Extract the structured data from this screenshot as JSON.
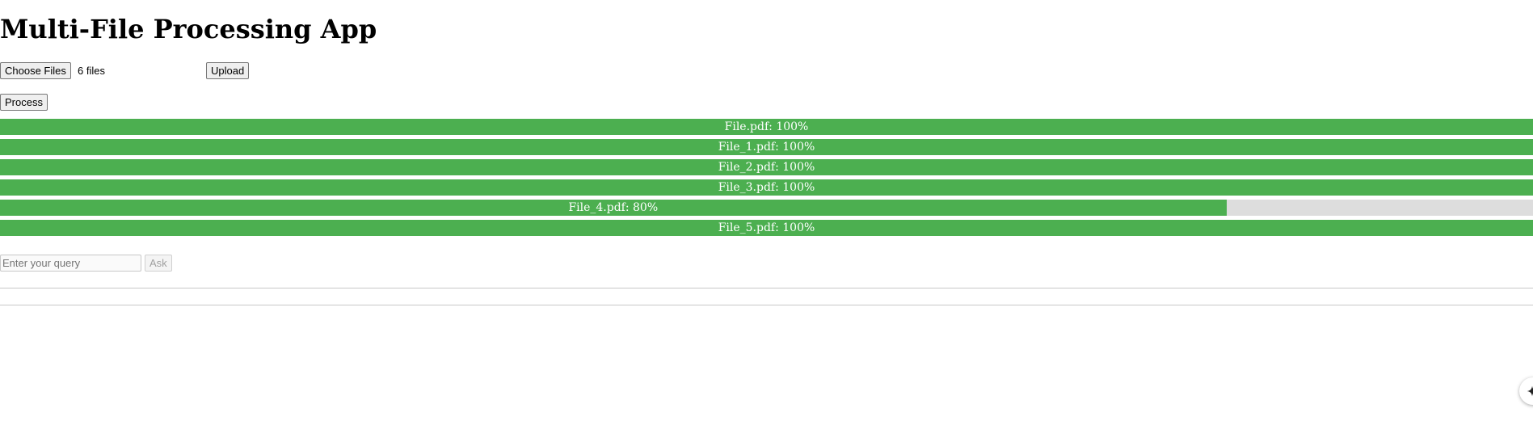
{
  "app": {
    "title": "Multi-File Processing App"
  },
  "upload": {
    "choose_files_label": "Choose Files",
    "file_count_text": "6 files",
    "upload_label": "Upload",
    "process_label": "Process"
  },
  "progress": {
    "fill_color": "#4caf50",
    "track_color": "#dddddd",
    "items": [
      {
        "label": "File.pdf: 100%",
        "percent": 100
      },
      {
        "label": "File_1.pdf: 100%",
        "percent": 100
      },
      {
        "label": "File_2.pdf: 100%",
        "percent": 100
      },
      {
        "label": "File_3.pdf: 100%",
        "percent": 100
      },
      {
        "label": "File_4.pdf: 80%",
        "percent": 80
      },
      {
        "label": "File_5.pdf: 100%",
        "percent": 100
      }
    ]
  },
  "query": {
    "placeholder": "Enter your query",
    "value": "",
    "ask_label": "Ask"
  },
  "assistant": {
    "icon": "sparkle-icon"
  }
}
